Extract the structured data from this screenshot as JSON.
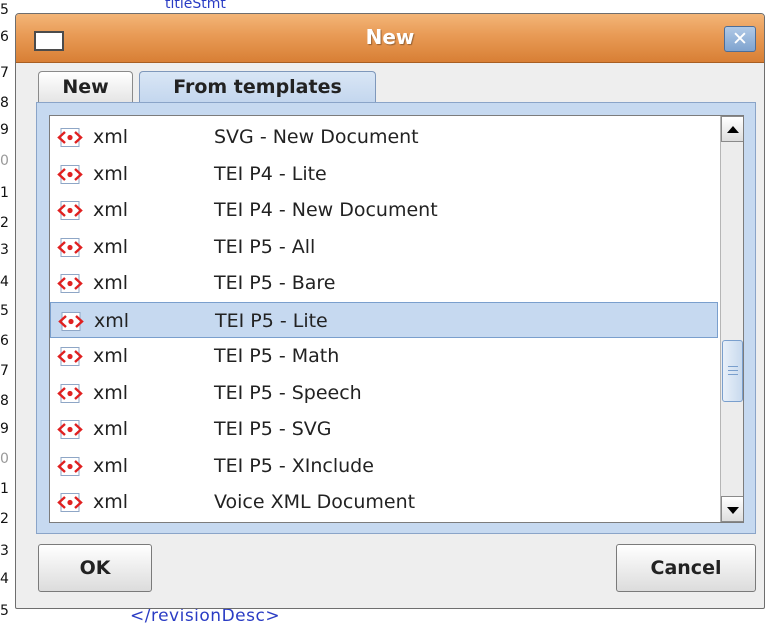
{
  "background": {
    "gutter_digits": [
      "5",
      "6",
      "7",
      "8",
      "9",
      "0",
      "1",
      "2",
      "3",
      "4",
      "5",
      "6",
      "7",
      "8",
      "9",
      "0",
      "1",
      "2",
      "3",
      "4",
      "5"
    ],
    "code_top": "titleStmt",
    "code_bottom": "</revisionDesc>"
  },
  "dialog": {
    "title": "New",
    "close_glyph": "✕"
  },
  "tabs": [
    {
      "label": "New",
      "selected": false
    },
    {
      "label": "From templates",
      "selected": true
    }
  ],
  "templates": [
    {
      "type": "xml",
      "name": "SVG - New Document"
    },
    {
      "type": "xml",
      "name": "TEI P4 - Lite"
    },
    {
      "type": "xml",
      "name": "TEI P4 - New Document"
    },
    {
      "type": "xml",
      "name": "TEI P5 - All"
    },
    {
      "type": "xml",
      "name": "TEI P5 - Bare"
    },
    {
      "type": "xml",
      "name": "TEI P5 - Lite",
      "selected": true
    },
    {
      "type": "xml",
      "name": "TEI P5 - Math"
    },
    {
      "type": "xml",
      "name": "TEI P5 - Speech"
    },
    {
      "type": "xml",
      "name": "TEI P5 - SVG"
    },
    {
      "type": "xml",
      "name": "TEI P5 - XInclude"
    },
    {
      "type": "xml",
      "name": "Voice XML Document"
    }
  ],
  "icons": {
    "row_icon": "xml-file-icon",
    "scroll_up": "arrow-up-icon",
    "scroll_down": "arrow-down-icon"
  },
  "colors": {
    "titlebar": "#e48a43",
    "selection": "#c6d9f0",
    "accent": "#7a9fcd"
  },
  "buttons": {
    "ok": "OK",
    "cancel": "Cancel"
  }
}
